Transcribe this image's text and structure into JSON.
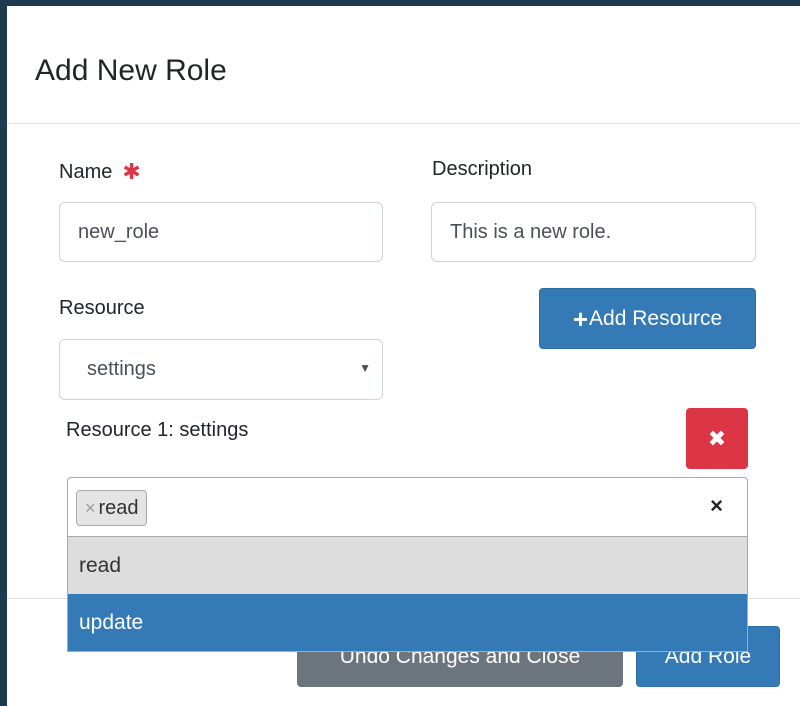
{
  "modal": {
    "title": "Add New Role"
  },
  "form": {
    "name_label": "Name",
    "name_required_mark": "✱",
    "name_value": "new_role",
    "description_label": "Description",
    "description_value": "This is a new role.",
    "resource_label": "Resource",
    "resource_selected": "settings",
    "add_resource_icon": "plus-icon",
    "add_resource_label": "Add Resource"
  },
  "resource_block": {
    "title": "Resource 1: settings",
    "remove_icon": "close-icon",
    "selected_tags": [
      "read"
    ],
    "tag_remove_glyph": "×",
    "clear_glyph": "×",
    "options": [
      {
        "label": "read",
        "state": "selected"
      },
      {
        "label": "update",
        "state": "highlighted"
      }
    ]
  },
  "footer": {
    "undo_label": "Undo Changes and Close",
    "add_role_label": "Add Role"
  },
  "colors": {
    "primary": "#337ab7",
    "danger": "#dc3545",
    "secondary": "#6c757d",
    "required": "#dc3545"
  }
}
